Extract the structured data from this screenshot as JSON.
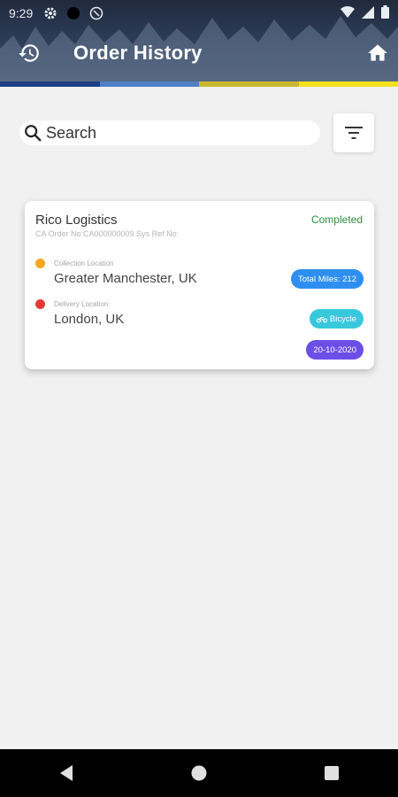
{
  "status_bar": {
    "time": "9:29",
    "icons": [
      "gear-icon",
      "circle-icon",
      "no-disturb-icon",
      "wifi-icon",
      "signal-icon",
      "battery-icon"
    ]
  },
  "appbar": {
    "title": "Order History",
    "left_icon": "history-icon",
    "right_icon": "home-icon"
  },
  "colors": {
    "strip": [
      "#1f3f86",
      "#4f7fc7",
      "#c9b82d",
      "#f2e21c"
    ],
    "status_completed": "#2e8b3d",
    "collection_dot": "#f5a623",
    "delivery_dot": "#e53935",
    "miles_pill": "#2f8ff0",
    "vehicle_pill": "#38c8dc",
    "date_pill": "#6b4fe6"
  },
  "search": {
    "placeholder": "Search",
    "value": ""
  },
  "filter": {
    "icon": "filter-icon"
  },
  "orders": [
    {
      "company": "Rico Logistics",
      "order_line": "CA Order No:CA000000009   Sys Ref No:",
      "status": "Completed",
      "collection_label": "Collection Location",
      "collection_value": "Greater Manchester, UK",
      "delivery_label": "Delivery Location",
      "delivery_value": "London, UK",
      "miles": "Total Miles: 212",
      "vehicle": "Bicycle",
      "date": "20-10-2020"
    }
  ],
  "navbar": {
    "icons": [
      "back-icon",
      "home-circle-icon",
      "recents-icon"
    ]
  }
}
